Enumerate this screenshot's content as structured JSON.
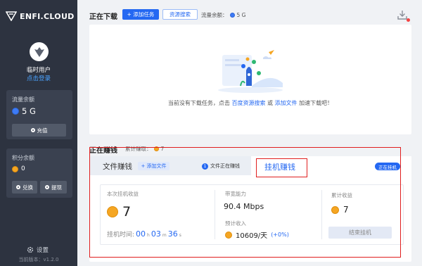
{
  "sidebar": {
    "brand": "ENFI.CLOUD",
    "user_name": "临时用户",
    "login_link": "点击登录",
    "flow_panel": {
      "title": "流量余额",
      "value": "5 G",
      "recharge_label": "充值"
    },
    "points_panel": {
      "title": "积分余额",
      "value": "0",
      "exchange_label": "兑换",
      "withdraw_label": "提现"
    },
    "settings_label": "设置",
    "version": "当前版本：v1.2.0"
  },
  "downloading": {
    "title": "正在下载",
    "add_task_label": "+ 添加任务",
    "resource_search_label": "资源搜索",
    "flow_label": "流量余额：",
    "flow_value": "5 G",
    "empty": {
      "prefix": "当前没有下载任务，点击",
      "link1": "百度资源搜索",
      "middle": "或",
      "link2": "添加文件",
      "suffix": "加速下载吧！"
    }
  },
  "earning": {
    "title": "正在赚钱",
    "cumulative_label": "累计赚取：",
    "cumulative_value": "7",
    "tabs": {
      "file": "文件赚钱",
      "add_file": "+ 添加文件",
      "file_status_num": "1",
      "file_status": "文件正在赚钱",
      "hang": "挂机赚钱",
      "hang_badge": "正在挂机"
    },
    "stats": {
      "session_label": "本次挂机收益",
      "session_value": "7",
      "hang_time_label": "挂机时间:",
      "hours": "00",
      "hours_unit": "h",
      "minutes": "03",
      "minutes_unit": "m",
      "seconds": "36",
      "seconds_unit": "s",
      "bandwidth_label": "带宽能力",
      "bandwidth_value": "90.4 Mbps",
      "income_label": "预计收入",
      "income_value": "10609/天",
      "income_pct": "(+0%)",
      "total_label": "累计收益",
      "total_value": "7",
      "stop_label": "结束挂机"
    }
  },
  "colors": {
    "sidebar_bg": "#2d3340",
    "accent": "#2468f2",
    "highlight_red": "#e01e1e",
    "coin": "#f5a623"
  }
}
